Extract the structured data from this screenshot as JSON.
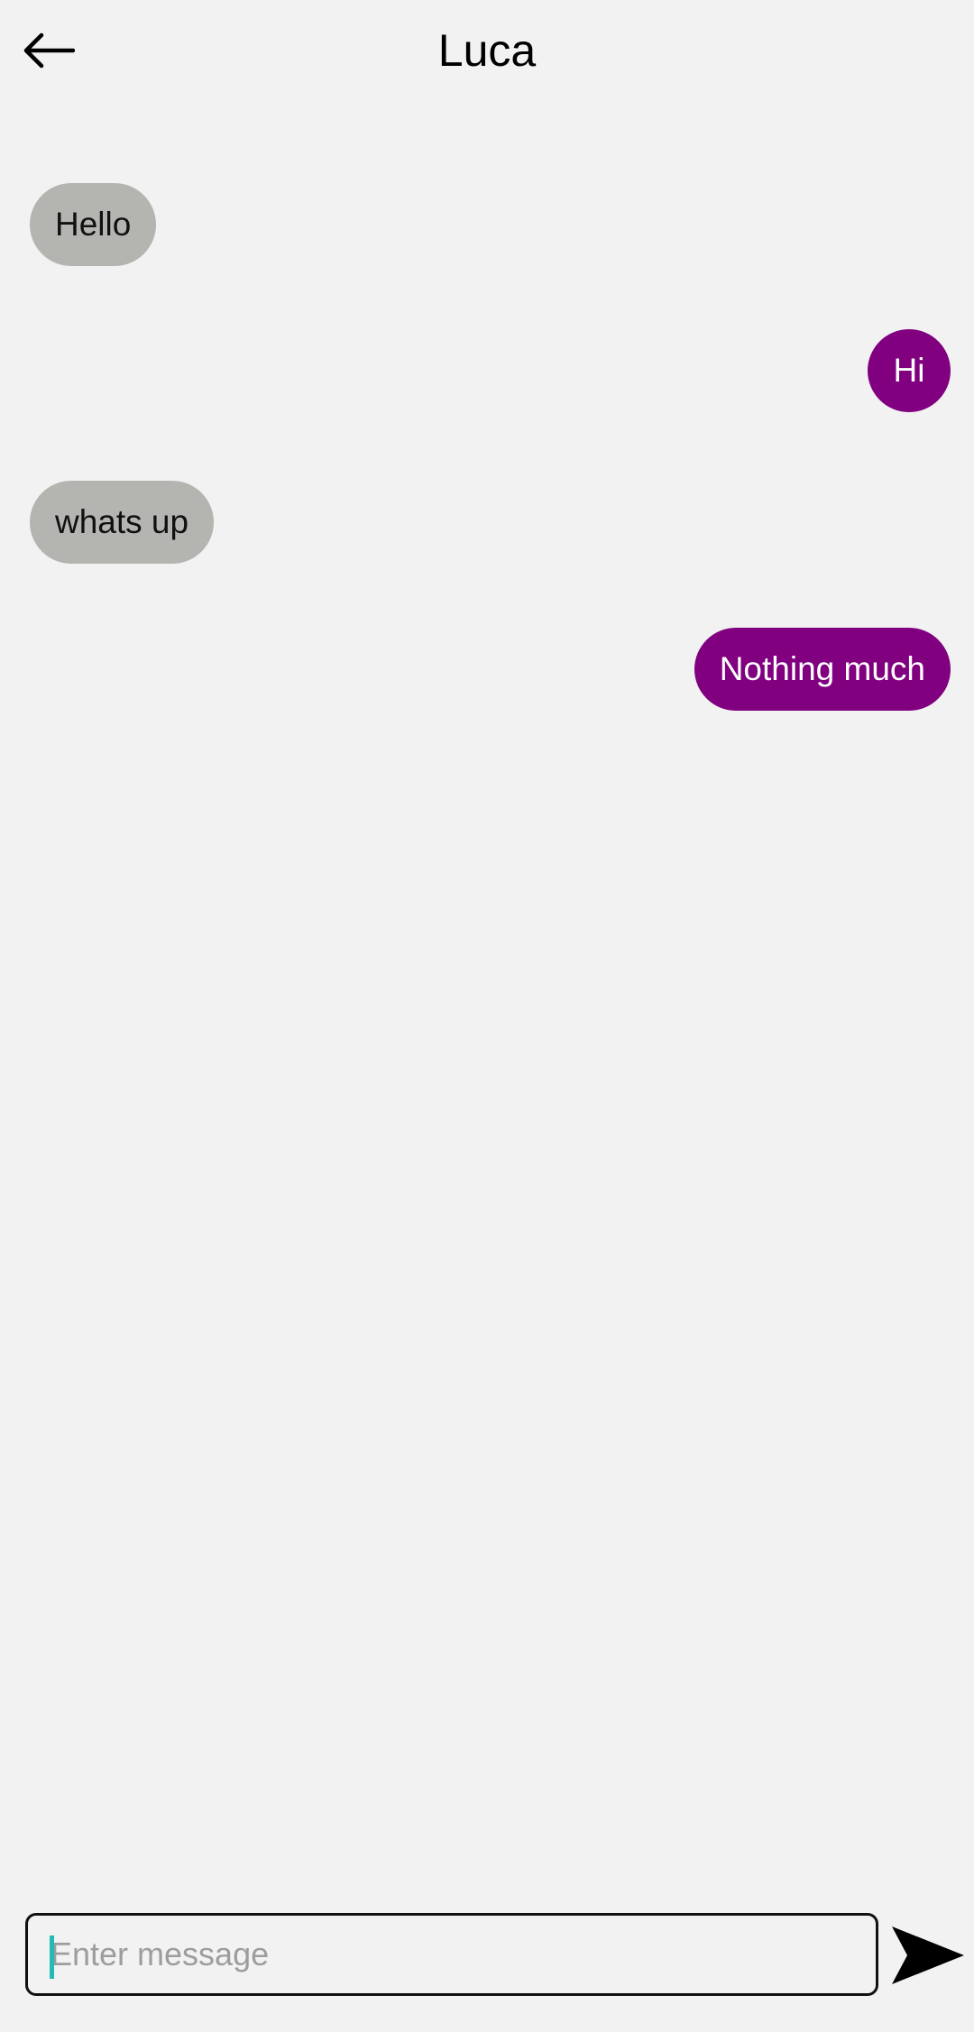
{
  "header": {
    "title": "Luca",
    "back_icon": "arrow-left-icon"
  },
  "messages": [
    {
      "text": "Hello",
      "direction": "incoming"
    },
    {
      "text": "Hi",
      "direction": "outgoing"
    },
    {
      "text": "whats up",
      "direction": "incoming"
    },
    {
      "text": "Nothing much",
      "direction": "outgoing"
    }
  ],
  "composer": {
    "value": "",
    "placeholder": "Enter message",
    "send_icon": "send-icon"
  },
  "colors": {
    "background": "#f2f2f2",
    "incoming_bubble": "#b4b4b1",
    "outgoing_bubble": "#800080",
    "caret": "#22bcb2"
  }
}
